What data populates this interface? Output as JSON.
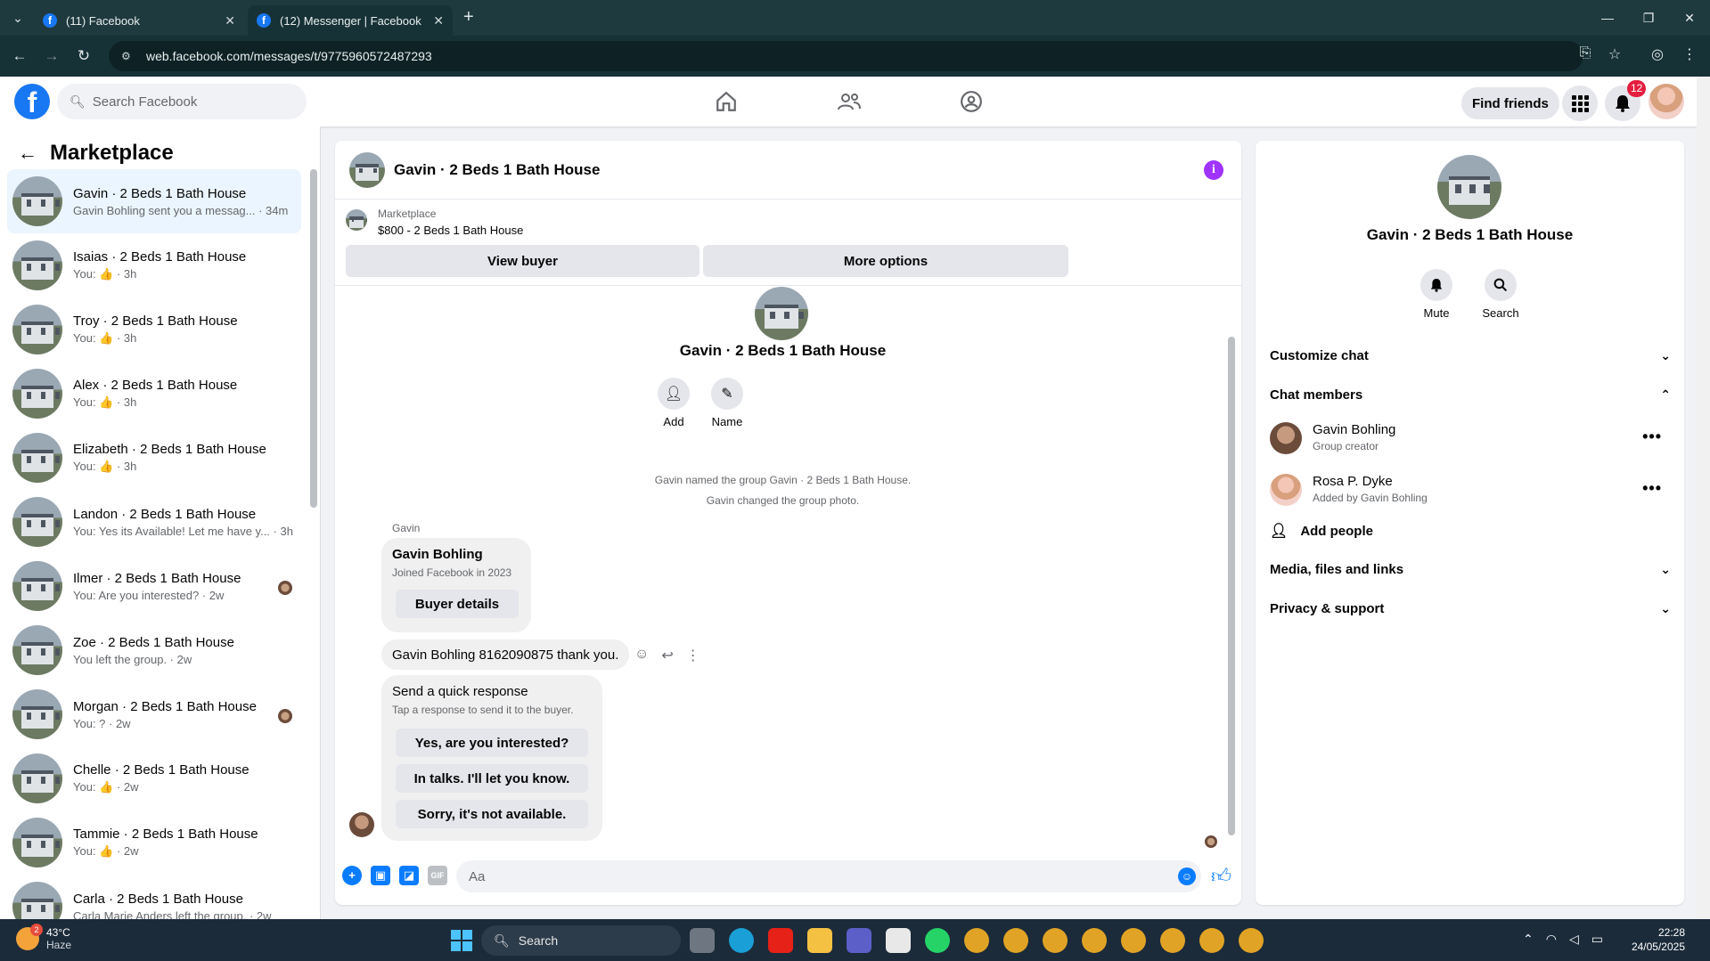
{
  "browser": {
    "tabs": [
      {
        "title": "(11) Facebook"
      },
      {
        "title": "(12) Messenger | Facebook"
      }
    ],
    "url": "web.facebook.com/messages/t/9775960572487293"
  },
  "header": {
    "logo": "f",
    "search_placeholder": "Search Facebook",
    "find_friends": "Find friends",
    "notification_count": "12"
  },
  "sidebar": {
    "title": "Marketplace",
    "conversations": [
      {
        "name": "Gavin · 2 Beds 1 Bath House",
        "snippet": "Gavin Bohling sent you a messag... · 34m",
        "active": true
      },
      {
        "name": "Isaias · 2 Beds 1 Bath House",
        "snippet": "You: 👍 · 3h"
      },
      {
        "name": "Troy · 2 Beds 1 Bath House",
        "snippet": "You: 👍 · 3h"
      },
      {
        "name": "Alex · 2 Beds 1 Bath House",
        "snippet": "You: 👍 · 3h"
      },
      {
        "name": "Elizabeth · 2 Beds 1 Bath House",
        "snippet": "You: 👍 · 3h"
      },
      {
        "name": "Landon · 2 Beds 1 Bath House",
        "snippet": "You: Yes its Available! Let me have y... · 3h"
      },
      {
        "name": "Ilmer · 2 Beds 1 Bath House",
        "snippet": "You: Are you interested? · 2w",
        "seen": true
      },
      {
        "name": "Zoe · 2 Beds 1 Bath House",
        "snippet": "You left the group. · 2w"
      },
      {
        "name": "Morgan · 2 Beds 1 Bath House",
        "snippet": "You: ? · 2w",
        "seen": true
      },
      {
        "name": "Chelle · 2 Beds 1 Bath House",
        "snippet": "You: 👍 · 2w"
      },
      {
        "name": "Tammie · 2 Beds 1 Bath House",
        "snippet": "You: 👍 · 2w"
      },
      {
        "name": "Carla · 2 Beds 1 Bath House",
        "snippet": "Carla Marie Anders left the group. · 2w"
      }
    ]
  },
  "chat": {
    "title": "Gavin · 2 Beds 1 Bath House",
    "marketplace_label": "Marketplace",
    "listing": "$800 - 2 Beds 1 Bath House",
    "view_buyer": "View buyer",
    "more_options": "More options",
    "group_title": "Gavin · 2 Beds 1 Bath House",
    "add_label": "Add",
    "name_label": "Name",
    "system_messages": [
      "Gavin named the group Gavin · 2 Beds 1 Bath House.",
      "Gavin changed the group photo."
    ],
    "sender": "Gavin",
    "buyer_card": {
      "name": "Gavin Bohling",
      "sub": "Joined Facebook in 2023",
      "button": "Buyer details"
    },
    "message": "Gavin Bohling 8162090875 thank you.",
    "quick_response": {
      "title": "Send a quick response",
      "subtitle": "Tap a response to send it to the buyer.",
      "options": [
        "Yes, are you interested?",
        "In talks. I'll let you know.",
        "Sorry, it's not available."
      ]
    },
    "composer_placeholder": "Aa"
  },
  "details": {
    "title": "Gavin · 2 Beds 1 Bath House",
    "mute": "Mute",
    "search": "Search",
    "customize_chat": "Customize chat",
    "chat_members": "Chat members",
    "members": [
      {
        "name": "Gavin Bohling",
        "sub": "Group creator"
      },
      {
        "name": "Rosa P. Dyke",
        "sub": "Added by Gavin Bohling"
      }
    ],
    "add_people": "Add people",
    "media": "Media, files and links",
    "privacy": "Privacy & support"
  },
  "taskbar": {
    "temp": "43°C",
    "condition": "Haze",
    "weather_badge": "2",
    "search": "Search",
    "time": "22:28",
    "date": "24/05/2025"
  },
  "colors": {
    "facebook_blue": "#1877f2",
    "messenger_blue": "#0a7cff",
    "info_purple": "#a033ff",
    "badge_red": "#e41e3f"
  }
}
